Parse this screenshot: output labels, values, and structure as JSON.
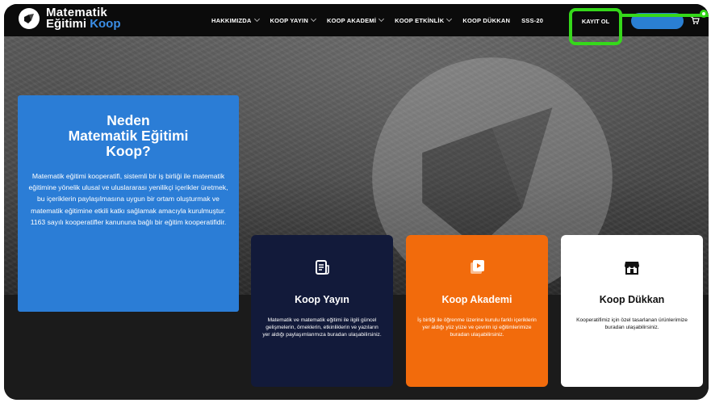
{
  "logo": {
    "line1": "Matematik",
    "line2a": "Eğitimi",
    "line2b": "Koop"
  },
  "nav": {
    "items": [
      "HAKKIMIZDA",
      "KOOP YAYIN",
      "KOOP AKADEMİ",
      "KOOP ETKİNLİK",
      "KOOP DÜKKAN",
      "SSS-20"
    ],
    "kayit": "KAYIT OL"
  },
  "intro": {
    "title_l1": "Neden",
    "title_l2": "Matematik Eğitimi",
    "title_l3": "Koop?",
    "text": "Matematik eğitimi kooperatifi, sistemli bir iş birliği ile matematik eğitimine yönelik ulusal ve uluslararası yenilikçi içerikler üretmek, bu içeriklerin paylaşılmasına uygun bir ortam oluşturmak ve matematik eğitimine etkili katkı sağlamak amacıyla kurulmuştur. 1163 sayılı kooperatifler kanununa bağlı bir eğitim kooperatifidir."
  },
  "cards": [
    {
      "title": "Koop Yayın",
      "icon": "document-icon",
      "text": "Matematik ve matematik eğitimi ile ilgili güncel gelişmelerin, örneklerin, etkinliklerin ve yazıların yer aldığı paylaşımlanmıza buradan ulaşabilirsiniz."
    },
    {
      "title": "Koop Akademi",
      "icon": "video-play-icon",
      "text": "İş birliği ile öğrenme üzerine kurulu farklı içeriklerin yer aldığı yüz yüze ve çevrim içi eğitimlerimize buradan ulaşabilirsiniz."
    },
    {
      "title": "Koop Dükkan",
      "icon": "store-icon",
      "text": "Kooperatifimiz için özel tasarlanan ürünlerimize buradan ulaşabilirsiniz."
    }
  ],
  "colors": {
    "accent": "#2b7dd6",
    "highlight": "#35d81a",
    "navy": "#121a3a",
    "orange": "#f26b0c"
  }
}
